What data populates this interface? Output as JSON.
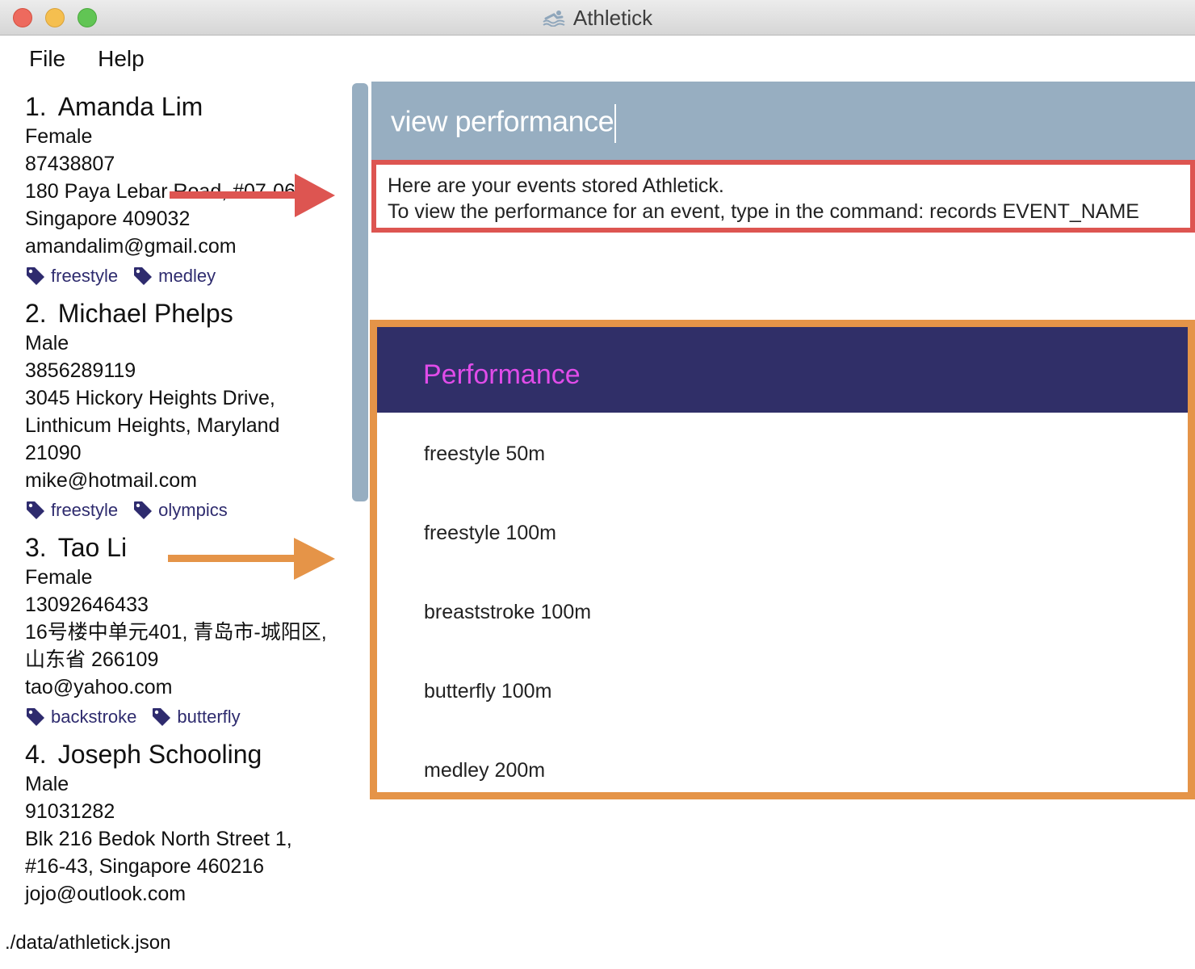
{
  "window": {
    "title": "Athletick"
  },
  "menu": [
    "File",
    "Help"
  ],
  "persons": [
    {
      "index": "1.",
      "name": "Amanda Lim",
      "lines": [
        "Female",
        "87438807",
        "180 Paya Lebar Road, #07-06",
        "Singapore 409032",
        "amandalim@gmail.com"
      ],
      "tags": [
        "freestyle",
        "medley"
      ]
    },
    {
      "index": "2.",
      "name": "Michael Phelps",
      "lines": [
        "Male",
        "3856289119",
        "3045 Hickory Heights Drive,",
        "Linthicum Heights, Maryland",
        "21090",
        "mike@hotmail.com"
      ],
      "tags": [
        "freestyle",
        "olympics"
      ]
    },
    {
      "index": "3.",
      "name": "Tao Li",
      "lines": [
        "Female",
        "13092646433",
        "16号楼中单元401, 青岛市-城阳区,",
        "山东省 266109",
        "tao@yahoo.com"
      ],
      "tags": [
        "backstroke",
        "butterfly"
      ]
    },
    {
      "index": "4.",
      "name": "Joseph Schooling",
      "lines": [
        "Male",
        "91031282",
        "Blk 216 Bedok North Street 1,",
        "#16-43, Singapore 460216",
        "jojo@outlook.com"
      ],
      "tags": []
    }
  ],
  "command": {
    "value": "view performance"
  },
  "result": {
    "line1": "Here are your events stored Athletick.",
    "line2": "To view the performance for an event, type in the command: records EVENT_NAME"
  },
  "performance": {
    "title": "Performance",
    "events": [
      "freestyle 50m",
      "freestyle 100m",
      "breaststroke 100m",
      "butterfly 100m",
      "medley 200m"
    ]
  },
  "status": {
    "path": "./data/athletick.json"
  },
  "colors": {
    "command_bg": "#97aec1",
    "result_border": "#dd5551",
    "performance_border": "#e59448",
    "performance_header": "#302f68",
    "performance_title": "#e04ce9",
    "tag_text": "#2e2b6e"
  }
}
